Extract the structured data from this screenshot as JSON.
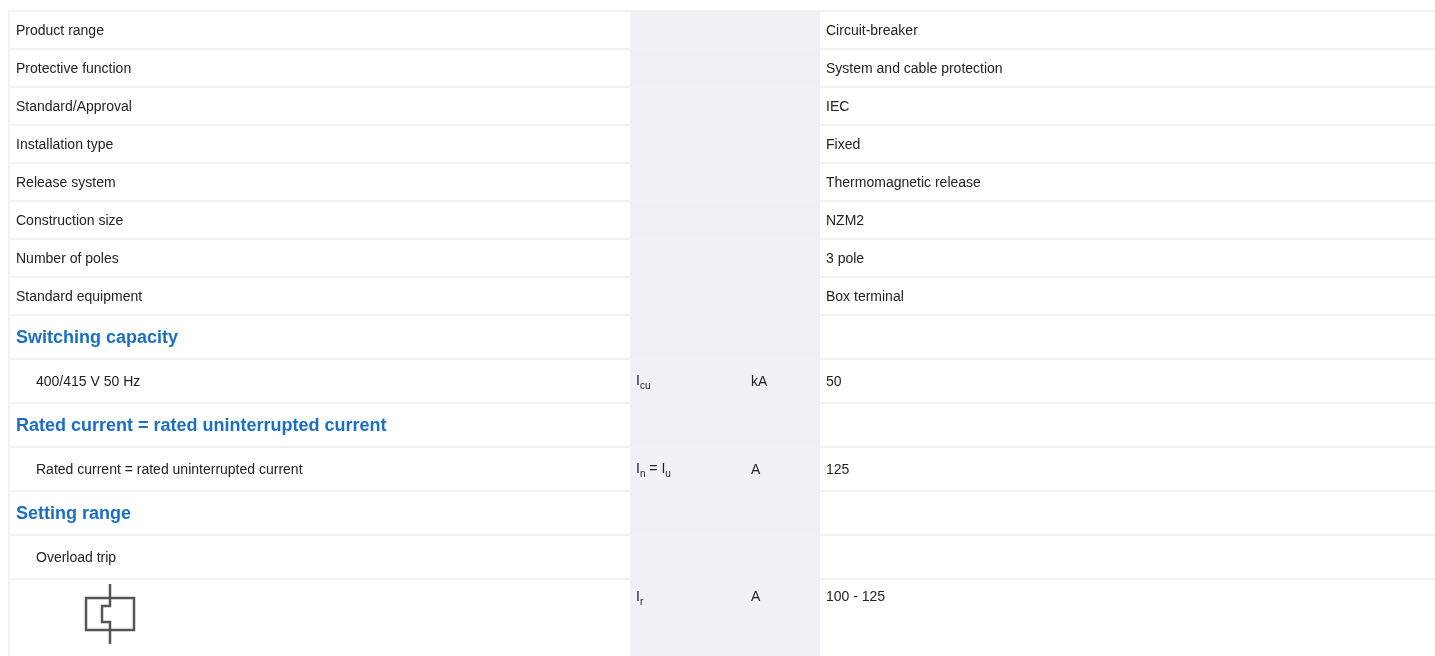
{
  "rows": [
    {
      "kind": "row",
      "label": "Product range",
      "value": "Circuit-breaker"
    },
    {
      "kind": "row",
      "label": "Protective function",
      "value": "System and cable protection"
    },
    {
      "kind": "row",
      "label": "Standard/Approval",
      "value": "IEC"
    },
    {
      "kind": "row",
      "label": "Installation type",
      "value": "Fixed"
    },
    {
      "kind": "row",
      "label": "Release system",
      "value": "Thermomagnetic release"
    },
    {
      "kind": "row",
      "label": "Construction size",
      "value": "NZM2"
    },
    {
      "kind": "row",
      "label": "Number of poles",
      "value": "3 pole"
    },
    {
      "kind": "row",
      "label": "Standard equipment",
      "value": "Box terminal"
    },
    {
      "kind": "section",
      "label": "Switching capacity"
    },
    {
      "kind": "subrow",
      "label": "400/415 V 50 Hz",
      "symbol": "I$_{cu}$",
      "unit": "kA",
      "value": "50"
    },
    {
      "kind": "section",
      "label": "Rated current = rated uninterrupted current"
    },
    {
      "kind": "subrow",
      "label": "Rated current = rated uninterrupted current",
      "symbol": "I$_{n}$ = I$_{u}$",
      "unit": "A",
      "value": "125"
    },
    {
      "kind": "section",
      "label": "Setting range"
    },
    {
      "kind": "subrow",
      "label": "Overload trip"
    },
    {
      "kind": "icon",
      "symbol": "I$_{r}$",
      "unit": "A",
      "value": "100 - 125"
    }
  ]
}
